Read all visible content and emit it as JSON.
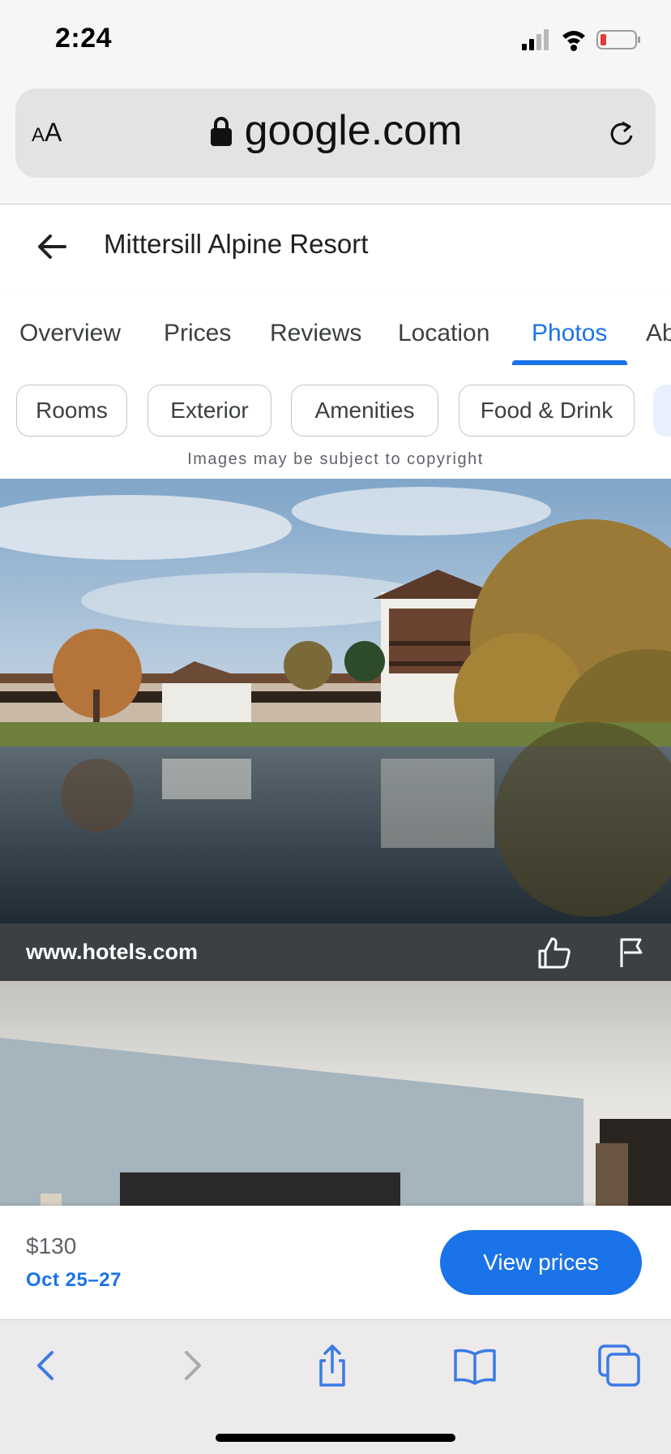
{
  "status_bar": {
    "time": "2:24",
    "icons": [
      "signal-icon",
      "wifi-icon",
      "battery-low-icon"
    ],
    "battery_color": "#e53935"
  },
  "browser": {
    "text_size_small": "A",
    "text_size_large": "A",
    "domain": "google.com",
    "icons": [
      "lock-icon",
      "reload-icon"
    ]
  },
  "header": {
    "title": "Mittersill Alpine Resort",
    "back_icon": "arrow-back-icon"
  },
  "tabs": [
    {
      "label": "Overview",
      "active": false
    },
    {
      "label": "Prices",
      "active": false
    },
    {
      "label": "Reviews",
      "active": false
    },
    {
      "label": "Location",
      "active": false
    },
    {
      "label": "Photos",
      "active": true
    },
    {
      "label": "Ab",
      "active": false
    }
  ],
  "filters": [
    {
      "label": "Rooms"
    },
    {
      "label": "Exterior"
    },
    {
      "label": "Amenities"
    },
    {
      "label": "Food & Drink"
    }
  ],
  "copyright_notice": "Images may be subject to copyright",
  "photos": [
    {
      "subject": "resort-exterior-lake-reflection",
      "source": "www.hotels.com",
      "actions": [
        "thumbs-up-icon",
        "flag-icon"
      ]
    },
    {
      "subject": "room-interior"
    }
  ],
  "footer": {
    "price": "$130",
    "dates": "Oct 25–27",
    "cta": "View prices"
  },
  "toolbar": {
    "items": [
      "back-icon",
      "forward-icon",
      "share-icon",
      "bookmarks-icon",
      "tabs-icon"
    ]
  },
  "colors": {
    "accent": "#1a73e8",
    "caption_bar": "#3c4043"
  }
}
